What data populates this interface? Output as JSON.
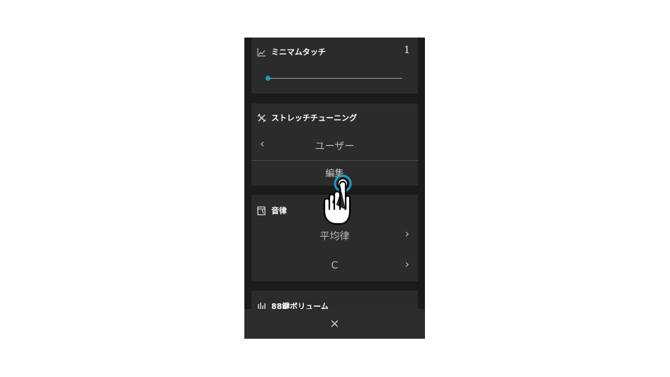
{
  "minimum_touch": {
    "title": "ミニマムタッチ",
    "value": "1",
    "slider_level": 0.0,
    "icon": "graph-icon"
  },
  "stretch_tuning": {
    "title": "ストレッチチューニング",
    "selected": "ユーザー",
    "edit_label": "編集",
    "icon": "tools-icon"
  },
  "temperament": {
    "title": "音律",
    "type": "平均律",
    "key": "C",
    "icon": "temperament-icon"
  },
  "key_volume": {
    "title": "88鍵ボリューム",
    "icon": "equalizer-icon"
  },
  "bottom_bar": {
    "close_symbol": "×"
  },
  "colors": {
    "accent": "#1e9bc0",
    "card_bg": "#2b2b2b",
    "panel_bg": "#1b1b1b"
  }
}
